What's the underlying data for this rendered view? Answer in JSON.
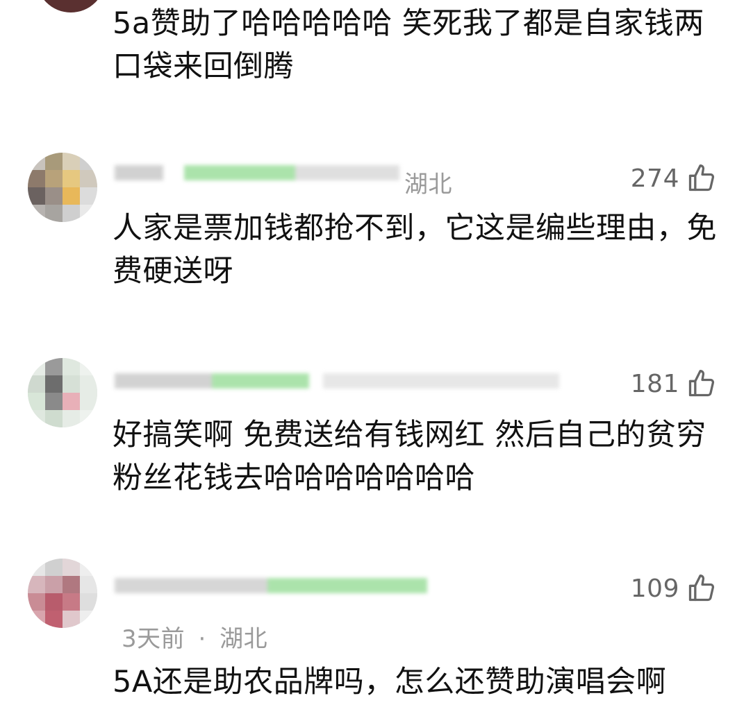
{
  "first_comment": {
    "text": "5a赞助了哈哈哈哈哈 笑死我了都是自家钱两口袋来回倒腾"
  },
  "comments": [
    {
      "location_fragment": "湖北",
      "likes": "274",
      "text": "人家是票加钱都抢不到，它这是编些理由，免费硬送呀"
    },
    {
      "likes": "181",
      "text": "好搞笑啊 免费送给有钱网红  然后自己的贫穷粉丝花钱去哈哈哈哈哈哈哈"
    },
    {
      "likes": "109",
      "time": "3天前",
      "separator": "·",
      "location": "湖北",
      "text": "5A还是助农品牌吗，怎么还赞助演唱会啊"
    }
  ],
  "icons": {
    "like": "thumbs-up-outline-icon"
  },
  "colors": {
    "body_text": "#111111",
    "meta_text": "#9a9a9a",
    "like_count": "#666666",
    "blur_green": "#8fd88f"
  }
}
